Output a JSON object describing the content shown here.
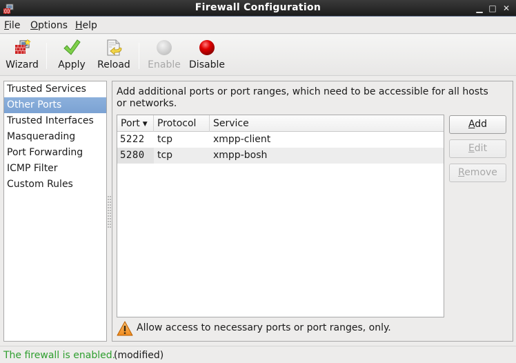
{
  "window": {
    "title": "Firewall Configuration",
    "app_icon": "firewall-icon",
    "controls": {
      "minimize": "▁",
      "maximize": "□",
      "close": "✕"
    }
  },
  "menubar": {
    "items": [
      {
        "label": "File",
        "mnemonic": "F",
        "rest": "ile"
      },
      {
        "label": "Options",
        "mnemonic": "O",
        "rest": "ptions"
      },
      {
        "label": "Help",
        "mnemonic": "H",
        "rest": "elp"
      }
    ]
  },
  "toolbar": {
    "buttons": [
      {
        "label": "Wizard",
        "icon": "wizard-icon",
        "enabled": true
      },
      {
        "label": "Apply",
        "icon": "checkmark-icon",
        "enabled": true
      },
      {
        "label": "Reload",
        "icon": "reload-icon",
        "enabled": true
      },
      {
        "label": "Enable",
        "icon": "enable-icon",
        "enabled": false
      },
      {
        "label": "Disable",
        "icon": "disable-icon",
        "enabled": true
      }
    ]
  },
  "sidebar": {
    "selected": "Other Ports",
    "items": [
      {
        "label": "Trusted Services"
      },
      {
        "label": "Other Ports"
      },
      {
        "label": "Trusted Interfaces"
      },
      {
        "label": "Masquerading"
      },
      {
        "label": "Port Forwarding"
      },
      {
        "label": "ICMP Filter"
      },
      {
        "label": "Custom Rules"
      }
    ]
  },
  "main": {
    "description": "Add additional ports or port ranges, which need to be accessible for all hosts or networks.",
    "table": {
      "columns": [
        {
          "label": "Port",
          "sort_indicator": "⌄"
        },
        {
          "label": "Protocol"
        },
        {
          "label": "Service"
        }
      ],
      "rows": [
        {
          "port": "5222",
          "protocol": "tcp",
          "service": "xmpp-client"
        },
        {
          "port": "5280",
          "protocol": "tcp",
          "service": "xmpp-bosh"
        }
      ]
    },
    "buttons": {
      "add": {
        "label": "Add",
        "mnemonic": "A",
        "rest": "dd",
        "enabled": true
      },
      "edit": {
        "label": "Edit",
        "mnemonic": "E",
        "rest": "dit",
        "enabled": false
      },
      "remove": {
        "label": "Remove",
        "mnemonic": "R",
        "rest": "emove",
        "enabled": false
      }
    },
    "warning": "Allow access to necessary ports or port ranges, only."
  },
  "statusbar": {
    "status": "The firewall is enabled.",
    "modified": "(modified)",
    "status_color": "#2e9e2e"
  }
}
